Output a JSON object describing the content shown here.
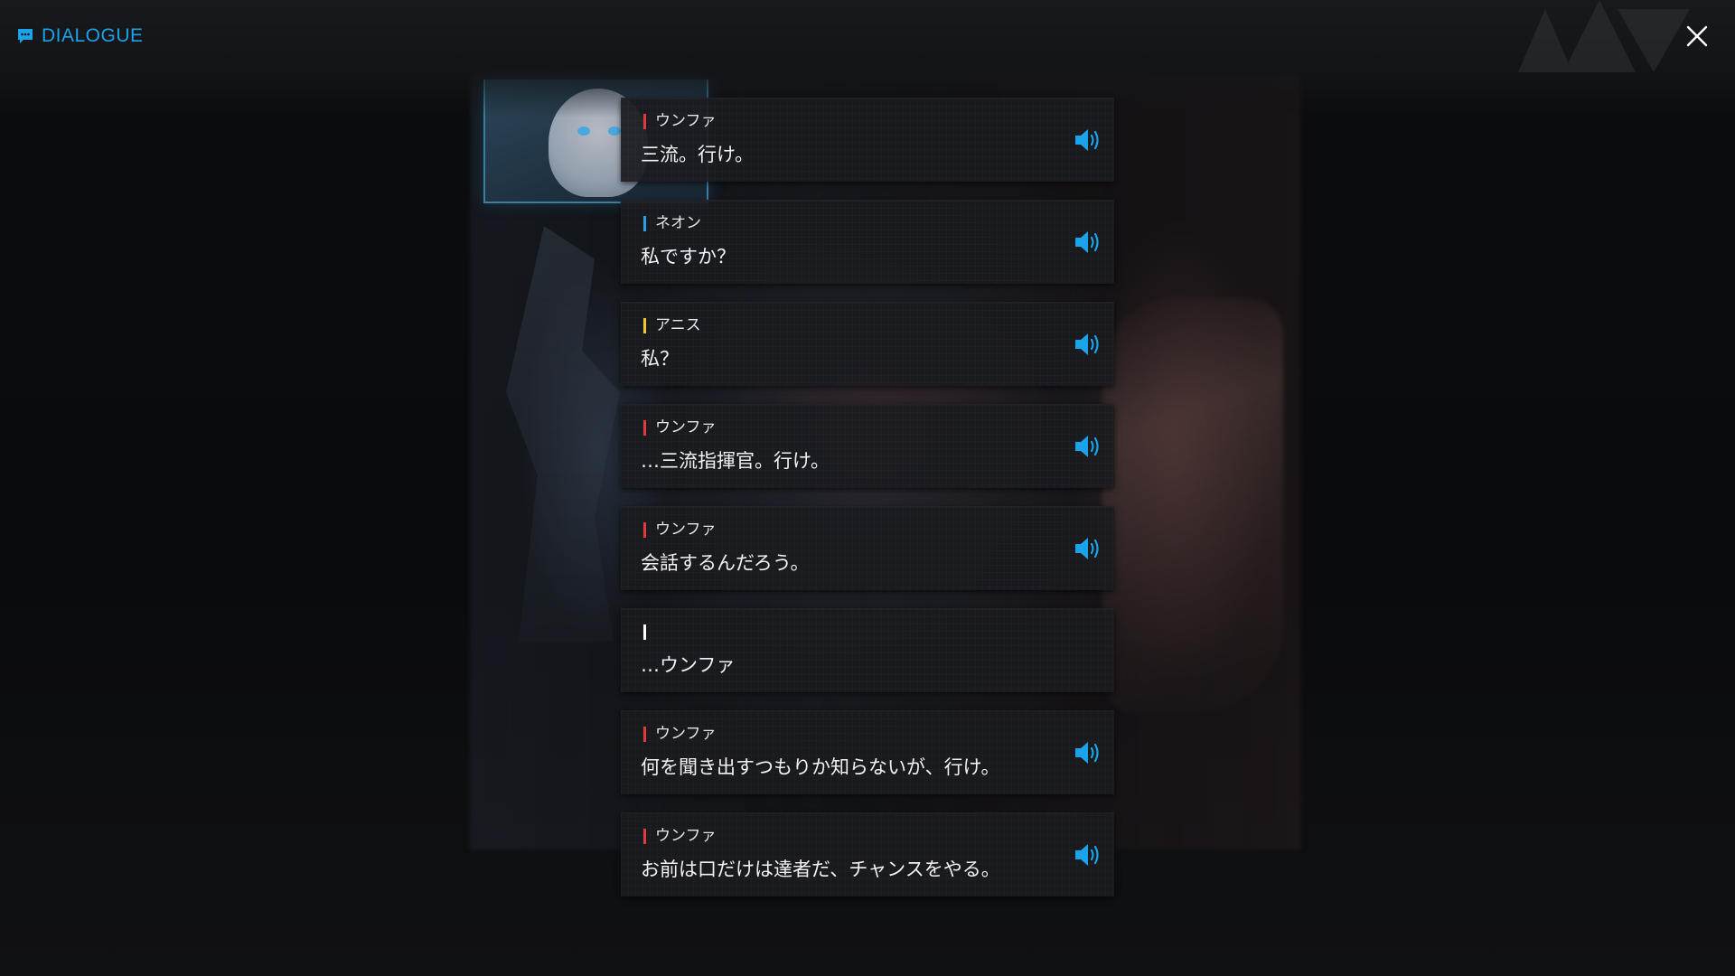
{
  "header": {
    "title": "DIALOGUE",
    "icon": "chat-bubble-icon"
  },
  "close_icon": "close-icon",
  "colors": {
    "accent": "#1aa3e8",
    "unfa": "#e03a3a",
    "neon": "#2a9fe6",
    "anis": "#f2c430",
    "narration": "#ffffff"
  },
  "entries": [
    {
      "speaker": "ウンファ",
      "color": "#e03a3a",
      "text": "三流。行け。",
      "voice": true
    },
    {
      "speaker": "ネオン",
      "color": "#2a9fe6",
      "text": "私ですか？",
      "voice": true
    },
    {
      "speaker": "アニス",
      "color": "#f2c430",
      "text": "私？",
      "voice": true
    },
    {
      "speaker": "ウンファ",
      "color": "#e03a3a",
      "text": "…三流指揮官。行け。",
      "voice": true
    },
    {
      "speaker": "ウンファ",
      "color": "#e03a3a",
      "text": "会話するんだろう。",
      "voice": true
    },
    {
      "speaker": "",
      "color": "#ffffff",
      "text": "…ウンファ",
      "voice": false
    },
    {
      "speaker": "ウンファ",
      "color": "#e03a3a",
      "text": "何を聞き出すつもりか知らないが、行け。",
      "voice": true
    },
    {
      "speaker": "ウンファ",
      "color": "#e03a3a",
      "text": "お前は口だけは達者だ、チャンスをやる。",
      "voice": true
    }
  ]
}
